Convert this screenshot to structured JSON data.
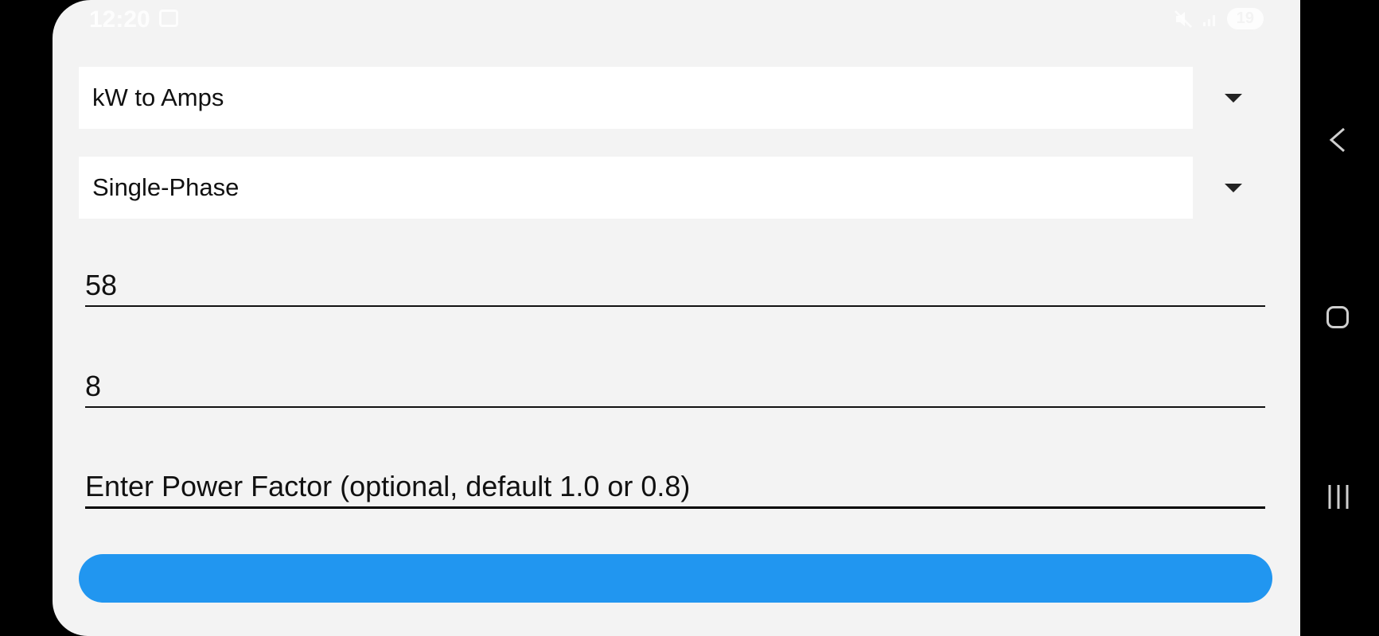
{
  "status_bar": {
    "time": "12:20",
    "battery": "19",
    "icons": [
      "screen-cast-icon",
      "mute-icon",
      "signal-icon",
      "battery-icon"
    ]
  },
  "calculator": {
    "conversion_select": {
      "selected": "kW to Amps"
    },
    "phase_select": {
      "selected": "Single-Phase"
    },
    "power_field": {
      "value": "58"
    },
    "voltage_field": {
      "value": "8"
    },
    "power_factor_field": {
      "value": "",
      "placeholder": "Enter Power Factor (optional, default 1.0 or 0.8)"
    },
    "calculate_button": {
      "label": "",
      "color": "#2196f0"
    }
  },
  "nav_bar": {
    "icons": [
      "back-icon",
      "home-icon",
      "recents-icon"
    ]
  }
}
